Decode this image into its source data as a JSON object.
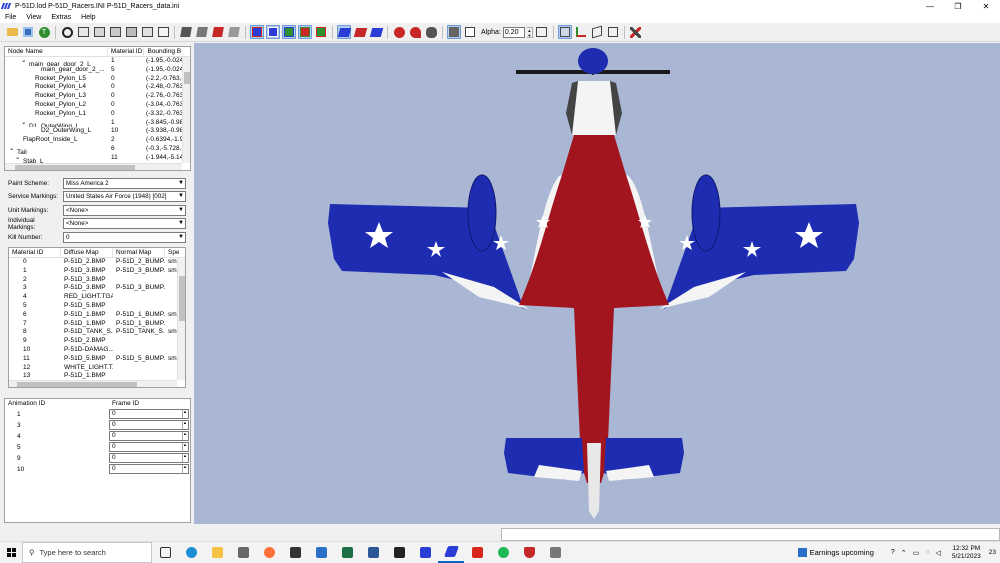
{
  "window": {
    "title": "P-51D.lod  P-51D_Racers.INI  P-51D_Racers_data.ini",
    "controls": [
      "—",
      "❐",
      "✕"
    ]
  },
  "menu": [
    "File",
    "View",
    "Extras",
    "Help"
  ],
  "toolbar": {
    "alpha_label": "Alpha:",
    "alpha_value": "0.20"
  },
  "node_tree": {
    "columns": [
      "Node Name",
      "Material ID",
      "Bounding B"
    ],
    "rows": [
      {
        "expander": "⌄",
        "indent": 2,
        "name": "main_gear_door_2_L",
        "material": "1",
        "bounds": "(-1.95,-0.024"
      },
      {
        "expander": "",
        "indent": 4,
        "name": "main_gear_door_2_...",
        "material": "5",
        "bounds": "(-1.95,-0.024"
      },
      {
        "expander": "",
        "indent": 3,
        "name": "Rocket_Pylon_L5",
        "material": "0",
        "bounds": "(-2.2,-0.763,-"
      },
      {
        "expander": "",
        "indent": 3,
        "name": "Rocket_Pylon_L4",
        "material": "0",
        "bounds": "(-2.48,-0.763"
      },
      {
        "expander": "",
        "indent": 3,
        "name": "Rocket_Pylon_L3",
        "material": "0",
        "bounds": "(-2.76,-0.763"
      },
      {
        "expander": "",
        "indent": 3,
        "name": "Rocket_Pylon_L2",
        "material": "0",
        "bounds": "(-3.04,-0.763"
      },
      {
        "expander": "",
        "indent": 3,
        "name": "Rocket_Pylon_L1",
        "material": "0",
        "bounds": "(-3.32,-0.763"
      },
      {
        "expander": "⌄",
        "indent": 2,
        "name": "D1_OuterWing_L",
        "material": "1",
        "bounds": "(-3.845,-0.98"
      },
      {
        "expander": "",
        "indent": 4,
        "name": "D2_OuterWing_L",
        "material": "10",
        "bounds": "(-3.938,-0.98"
      },
      {
        "expander": "",
        "indent": 1,
        "name": "FlapRoot_Inside_L",
        "material": "2",
        "bounds": "(-0.6394,-1.9"
      },
      {
        "expander": "⌄",
        "indent": 0,
        "name": "Tail",
        "material": "6",
        "bounds": "(-0.3,-5.728,-"
      },
      {
        "expander": "⌄",
        "indent": 1,
        "name": "Stab_L",
        "material": "11",
        "bounds": "(-1.944,-5.14"
      }
    ]
  },
  "properties": [
    {
      "label": "Paint Scheme:",
      "value": "Miss America 2"
    },
    {
      "label": "Service Markings:",
      "value": "United States Air Force (1948) [002]"
    },
    {
      "label": "Unit Markings:",
      "value": "<None>"
    },
    {
      "label": "Individual Markings:",
      "value": "<None>"
    },
    {
      "label": "Kill Number:",
      "value": "0"
    }
  ],
  "materials": {
    "columns": [
      "Material ID",
      "Diffuse Map",
      "Normal Map",
      "Spe"
    ],
    "rows": [
      [
        "0",
        "P-51D_2.BMP",
        "P-51D_2_BUMP....",
        "sm"
      ],
      [
        "1",
        "P-51D_3.BMP",
        "P-51D_3_BUMP....",
        "sm"
      ],
      [
        "2",
        "P-51D_3.BMP",
        "",
        ""
      ],
      [
        "3",
        "P-51D_3.BMP",
        "P-51D_3_BUMP....",
        ""
      ],
      [
        "4",
        "RED_LIGHT.TGA",
        "",
        ""
      ],
      [
        "5",
        "P-51D_5.BMP",
        "",
        ""
      ],
      [
        "6",
        "P-51D_1.BMP",
        "P-51D_1_BUMP....",
        "sm"
      ],
      [
        "7",
        "P-51D_1.BMP",
        "P-51D_1_BUMP....",
        ""
      ],
      [
        "8",
        "P-51D_TANK_S...",
        "P-51D_TANK_S...",
        "sm"
      ],
      [
        "9",
        "P-51D_2.BMP",
        "",
        ""
      ],
      [
        "10",
        "P-51D-DAMAG...",
        "",
        ""
      ],
      [
        "11",
        "P-51D_5.BMP",
        "P-51D_5_BUMP....",
        "sm"
      ],
      [
        "12",
        "WHITE_LIGHT.T...",
        "",
        ""
      ],
      [
        "13",
        "P-51D_1.BMP",
        "",
        ""
      ]
    ]
  },
  "animations": {
    "columns": [
      "Animation ID",
      "Frame ID"
    ],
    "rows": [
      [
        "1",
        "0"
      ],
      [
        "3",
        "0"
      ],
      [
        "4",
        "0"
      ],
      [
        "5",
        "0"
      ],
      [
        "9",
        "0"
      ],
      [
        "10",
        "0"
      ]
    ]
  },
  "colors": {
    "viewport_bg": "#a9b6d4",
    "paint_blue": "#1d2cb0",
    "paint_red": "#a2151e",
    "paint_white": "#f4f4f4"
  },
  "taskbar": {
    "search_placeholder": "Type here to search",
    "news": "Earnings upcoming",
    "time": "12:32 PM",
    "date": "5/21/2023",
    "notif": "23"
  }
}
